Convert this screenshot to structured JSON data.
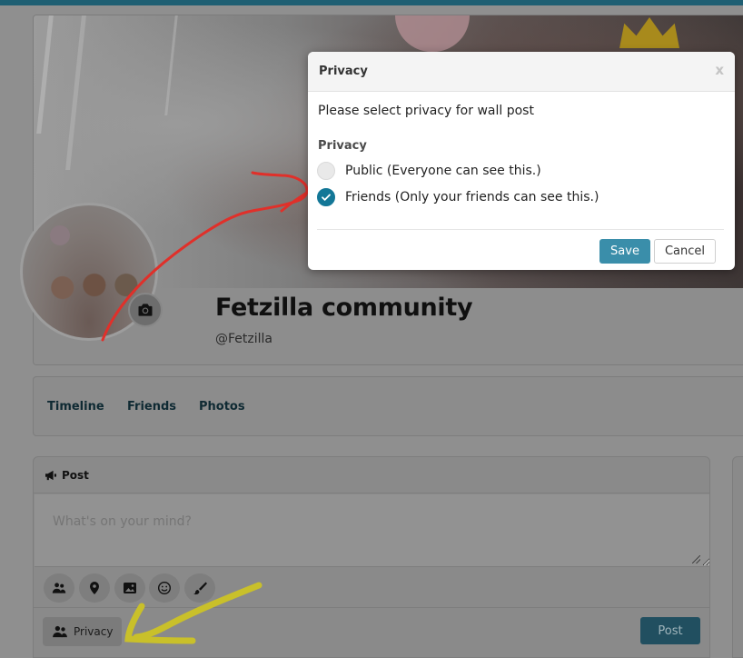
{
  "profile": {
    "name": "Fetzilla community",
    "handle": "@Fetzilla"
  },
  "tabs": [
    {
      "label": "Timeline"
    },
    {
      "label": "Friends"
    },
    {
      "label": "Photos"
    }
  ],
  "post": {
    "header_label": "Post",
    "header_icon": "megaphone-icon",
    "placeholder": "What's on your mind?",
    "tools": [
      "users-icon",
      "map-marker-icon",
      "image-icon",
      "smile-icon",
      "brush-icon"
    ],
    "privacy_label": "Privacy",
    "privacy_icon": "users-icon",
    "submit_label": "Post"
  },
  "modal": {
    "title": "Privacy",
    "close_label": "x",
    "message": "Please select privacy for wall post",
    "field_label": "Privacy",
    "options": [
      {
        "label": "Public (Everyone can see this.)",
        "checked": false
      },
      {
        "label": "Friends (Only your friends can see this.)",
        "checked": true
      }
    ],
    "save_label": "Save",
    "cancel_label": "Cancel"
  },
  "colors": {
    "accent": "#137797",
    "save_button": "#3a8eaa",
    "annotation_red": "#e0302a",
    "annotation_yellow": "#c9c02a"
  }
}
